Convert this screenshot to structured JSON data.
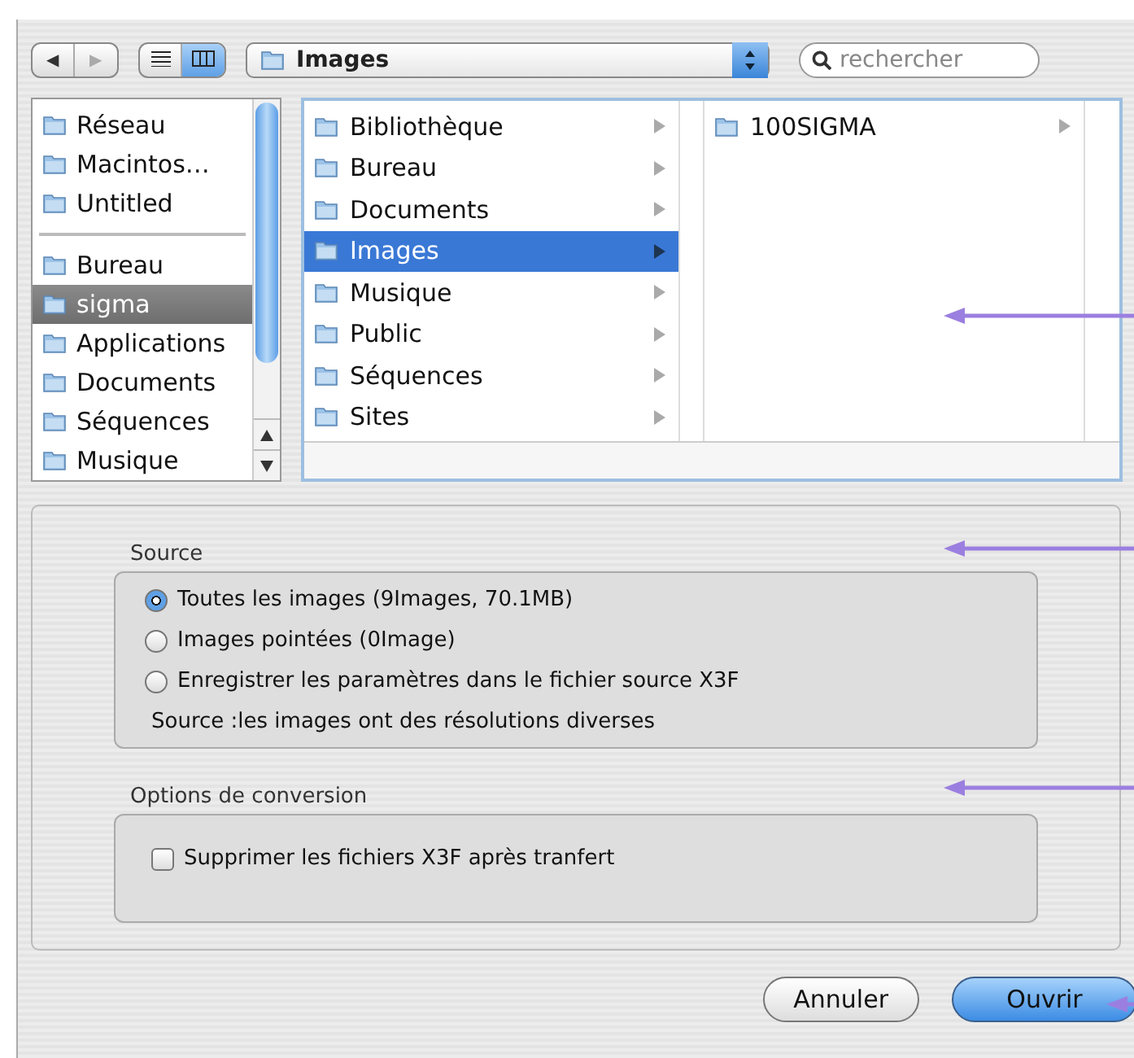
{
  "toolbar": {
    "nav_buttons": [
      {
        "glyph": "◀",
        "disabled": false
      },
      {
        "glyph": "▶",
        "disabled": true
      }
    ],
    "view_buttons": [
      {
        "kind": "list",
        "selected": false
      },
      {
        "kind": "columns",
        "selected": true
      }
    ],
    "location": "Images",
    "search": {
      "placeholder": "rechercher"
    }
  },
  "sidebar": {
    "sections": [
      {
        "items": [
          {
            "label": "Réseau",
            "selected": false
          },
          {
            "label": "Macintos…",
            "selected": false
          },
          {
            "label": "Untitled",
            "selected": false
          }
        ]
      },
      {
        "items": [
          {
            "label": "Bureau",
            "selected": false
          },
          {
            "label": "sigma",
            "selected": true
          },
          {
            "label": "Applications",
            "selected": false
          },
          {
            "label": "Documents",
            "selected": false
          },
          {
            "label": "Séquences",
            "selected": false
          },
          {
            "label": "Musique",
            "selected": false
          }
        ]
      }
    ]
  },
  "browser": {
    "columns": [
      {
        "items": [
          {
            "label": "Bibliothèque",
            "selected": false
          },
          {
            "label": "Bureau",
            "selected": false
          },
          {
            "label": "Documents",
            "selected": false
          },
          {
            "label": "Images",
            "selected": true
          },
          {
            "label": "Musique",
            "selected": false
          },
          {
            "label": "Public",
            "selected": false
          },
          {
            "label": "Séquences",
            "selected": false
          },
          {
            "label": "Sites",
            "selected": false
          }
        ]
      },
      {
        "items": [
          {
            "label": "100SIGMA",
            "selected": false
          }
        ]
      }
    ]
  },
  "source": {
    "title": "Source",
    "options": [
      {
        "label": "Toutes les images (9Images, 70.1MB)",
        "selected": true
      },
      {
        "label": "Images pointées (0Image)",
        "selected": false
      },
      {
        "label": "Enregistrer les paramètres dans le fichier source  X3F",
        "selected": false
      }
    ],
    "note": "Source :les images ont des résolutions diverses"
  },
  "conversion": {
    "title": "Options de conversion",
    "options": [
      {
        "label": "Supprimer les fichiers X3F après tranfert",
        "checked": false
      }
    ]
  },
  "buttons": [
    {
      "label": "Annuler",
      "kind": "normal"
    },
    {
      "label": "Ouvrir",
      "kind": "default"
    }
  ]
}
